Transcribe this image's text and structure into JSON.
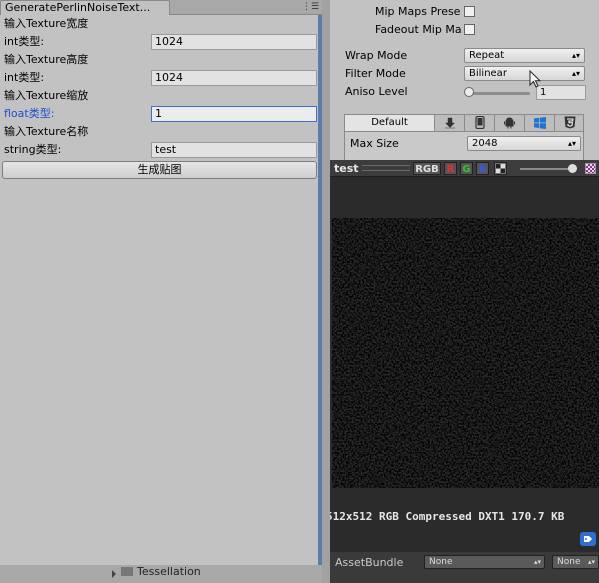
{
  "left_panel": {
    "tab_title": "GeneratePerlinNoiseText...",
    "fields": [
      {
        "caption": "输入Texture宽度",
        "type_label": "int类型:",
        "value": "1024",
        "focused": false
      },
      {
        "caption": "输入Texture高度",
        "type_label": "int类型:",
        "value": "1024",
        "focused": false
      },
      {
        "caption": "输入Texture缩放",
        "type_label": "float类型:",
        "value": "1",
        "focused": true
      },
      {
        "caption": "输入Texture名称",
        "type_label": "string类型:",
        "value": "test",
        "focused": false
      }
    ],
    "generate_button": "生成贴图",
    "bottom_tree_item": "Tessellation"
  },
  "inspector": {
    "mip_maps_preserve_label": "Mip Maps Prese",
    "fadeout_mip_label": "Fadeout Mip Ma",
    "wrap_mode_label": "Wrap Mode",
    "wrap_mode_value": "Repeat",
    "filter_mode_label": "Filter Mode",
    "filter_mode_value": "Bilinear",
    "aniso_level_label": "Aniso Level",
    "aniso_level_value": "1",
    "aniso_level_fraction": 0.0,
    "platform_tabs": {
      "default_label": "Default",
      "icons": [
        "download-icon",
        "mobile-icon",
        "android-icon",
        "windows-icon",
        "html5-icon"
      ]
    },
    "max_size_label": "Max Size",
    "max_size_value": "2048"
  },
  "preview": {
    "title": "test",
    "channels": {
      "rgb": "RGB",
      "r": "R",
      "g": "G",
      "b": "B"
    },
    "info": "512x512  RGB Compressed DXT1  170.7 KB",
    "assetbundle_label": "AssetBundle",
    "assetbundle_name": "None",
    "assetbundle_variant": "None"
  },
  "colors": {
    "focus_text": "#1a4fd0",
    "channel_r": "#e03030",
    "channel_g": "#36c036",
    "channel_b": "#3a58e0",
    "tag_blue": "#2f6fd1"
  }
}
